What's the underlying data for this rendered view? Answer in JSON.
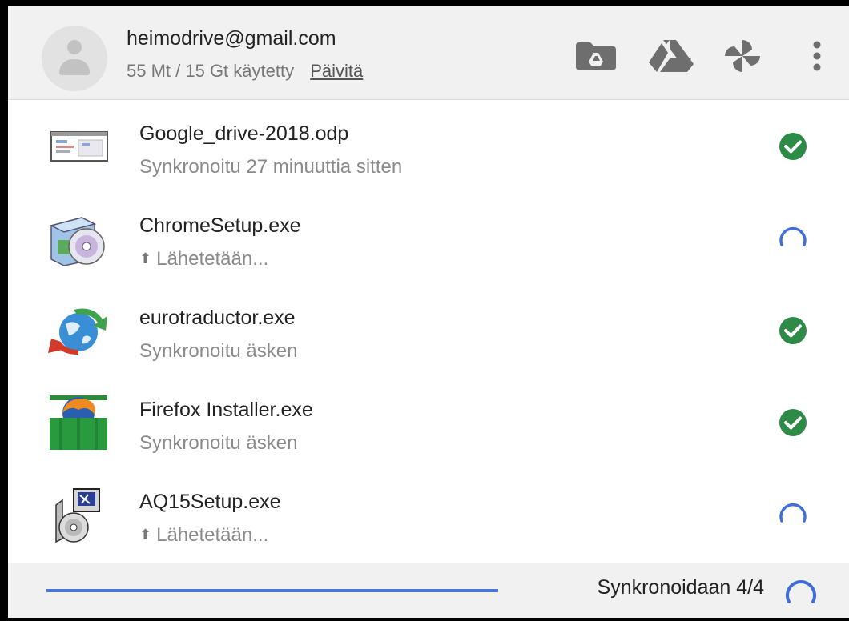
{
  "account": {
    "email": "heimodrive@gmail.com",
    "usage": "55 Mt / 15 Gt käytetty",
    "upgrade_label": "Päivitä"
  },
  "header_icons": [
    "drive-folder-icon",
    "google-drive-icon",
    "google-photos-icon",
    "more-vert-icon"
  ],
  "colors": {
    "synced": "#2e8a47",
    "syncing": "#3f6ed8",
    "progress": "#4a78d8"
  },
  "files": [
    {
      "name": "Google_drive-2018.odp",
      "status": "Synkronoitu 27 minuuttia sitten",
      "state": "synced",
      "icon": "presentation-file-icon"
    },
    {
      "name": "ChromeSetup.exe",
      "status": "Lähetetään...",
      "state": "uploading",
      "icon": "installer-cd-icon"
    },
    {
      "name": "eurotraductor.exe",
      "status": "Synkronoitu äsken",
      "state": "synced",
      "icon": "globe-arrows-icon"
    },
    {
      "name": "Firefox Installer.exe",
      "status": "Synkronoitu äsken",
      "state": "synced",
      "icon": "firefox-installer-icon"
    },
    {
      "name": "AQ15Setup.exe",
      "status": "Lähetetään...",
      "state": "uploading",
      "icon": "setup-cd-icon"
    }
  ],
  "footer": {
    "sync_label": "Synkronoidaan 4/4",
    "progress_fraction": 1.0
  }
}
